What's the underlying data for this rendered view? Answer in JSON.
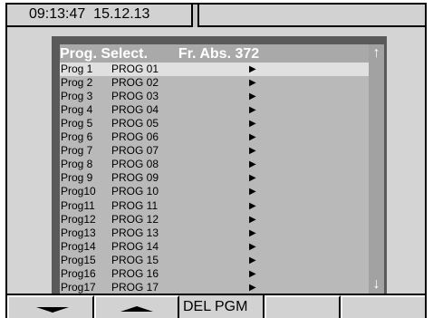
{
  "status": {
    "time": "09:13:47",
    "date": "15.12.13"
  },
  "window": {
    "title": "Prog. Select.",
    "subtitle": "Fr. Abs. 372"
  },
  "programs": [
    {
      "id": "Prog 1",
      "name": "PROG 01",
      "marker": "▶"
    },
    {
      "id": "Prog 2",
      "name": "PROG 02",
      "marker": "▶"
    },
    {
      "id": "Prog 3",
      "name": "PROG 03",
      "marker": "▶"
    },
    {
      "id": "Prog 4",
      "name": "PROG 04",
      "marker": "▶"
    },
    {
      "id": "Prog 5",
      "name": "PROG 05",
      "marker": "▶"
    },
    {
      "id": "Prog 6",
      "name": "PROG 06",
      "marker": "▶"
    },
    {
      "id": "Prog 7",
      "name": "PROG 07",
      "marker": "▶"
    },
    {
      "id": "Prog 8",
      "name": "PROG 08",
      "marker": "▶"
    },
    {
      "id": "Prog 9",
      "name": "PROG 09",
      "marker": "▶"
    },
    {
      "id": "Prog10",
      "name": "PROG 10",
      "marker": "▶"
    },
    {
      "id": "Prog11",
      "name": "PROG 11",
      "marker": "▶"
    },
    {
      "id": "Prog12",
      "name": "PROG 12",
      "marker": "▶"
    },
    {
      "id": "Prog13",
      "name": "PROG 13",
      "marker": "▶"
    },
    {
      "id": "Prog14",
      "name": "PROG 14",
      "marker": "▶"
    },
    {
      "id": "Prog15",
      "name": "PROG 15",
      "marker": "▶"
    },
    {
      "id": "Prog16",
      "name": "PROG 16",
      "marker": "▶"
    },
    {
      "id": "Prog17",
      "name": "PROG 17",
      "marker": "▶"
    }
  ],
  "selected_index": 0,
  "scrollbar": {
    "up_icon": "arrow-up-icon",
    "down_icon": "arrow-down-icon"
  },
  "softkeys": {
    "key1_icon": "triangle-down-icon",
    "key2_icon": "triangle-up-icon",
    "key3_label": "DEL PGM",
    "key4_label": "",
    "key5_label": ""
  },
  "colors": {
    "selected_row": "#e0e0e0",
    "list_background": "#b9b9b9",
    "title_text": "#ffffff"
  }
}
